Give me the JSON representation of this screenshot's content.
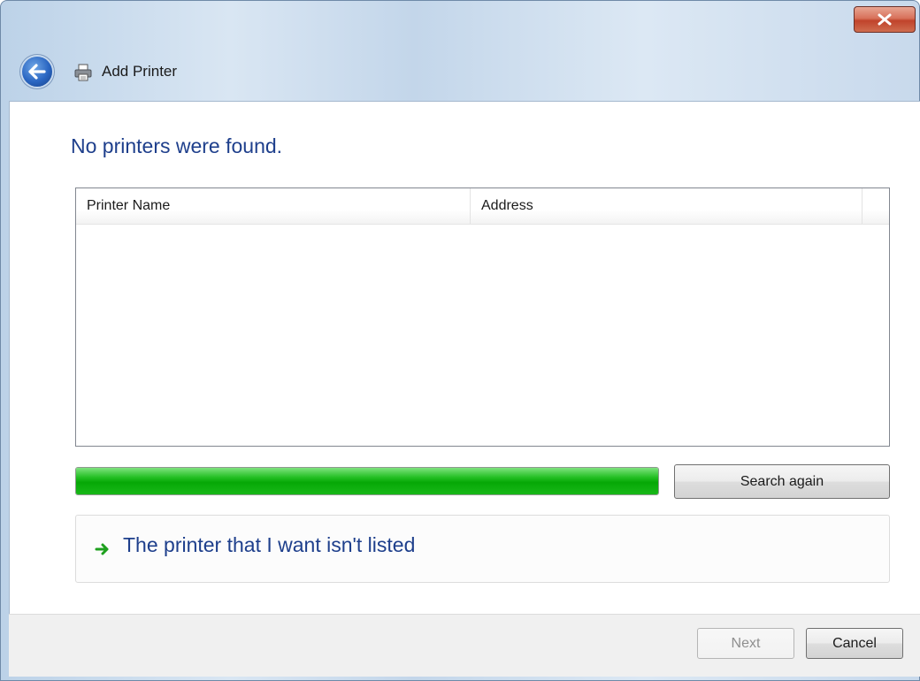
{
  "window": {
    "title": "Add Printer",
    "close_label": "x"
  },
  "main": {
    "heading": "No printers were found.",
    "columns": [
      "Printer Name",
      "Address"
    ],
    "rows": [],
    "progress_percent": 100,
    "search_again_label": "Search again",
    "not_listed_link": "The printer that I want isn't listed"
  },
  "footer": {
    "next_label": "Next",
    "next_enabled": false,
    "cancel_label": "Cancel"
  },
  "colors": {
    "heading": "#1e3f8c",
    "progress": "#06a806",
    "close": "#c0432b"
  },
  "icons": [
    "close-icon",
    "back-arrow-icon",
    "printer-icon",
    "green-arrow-icon"
  ]
}
